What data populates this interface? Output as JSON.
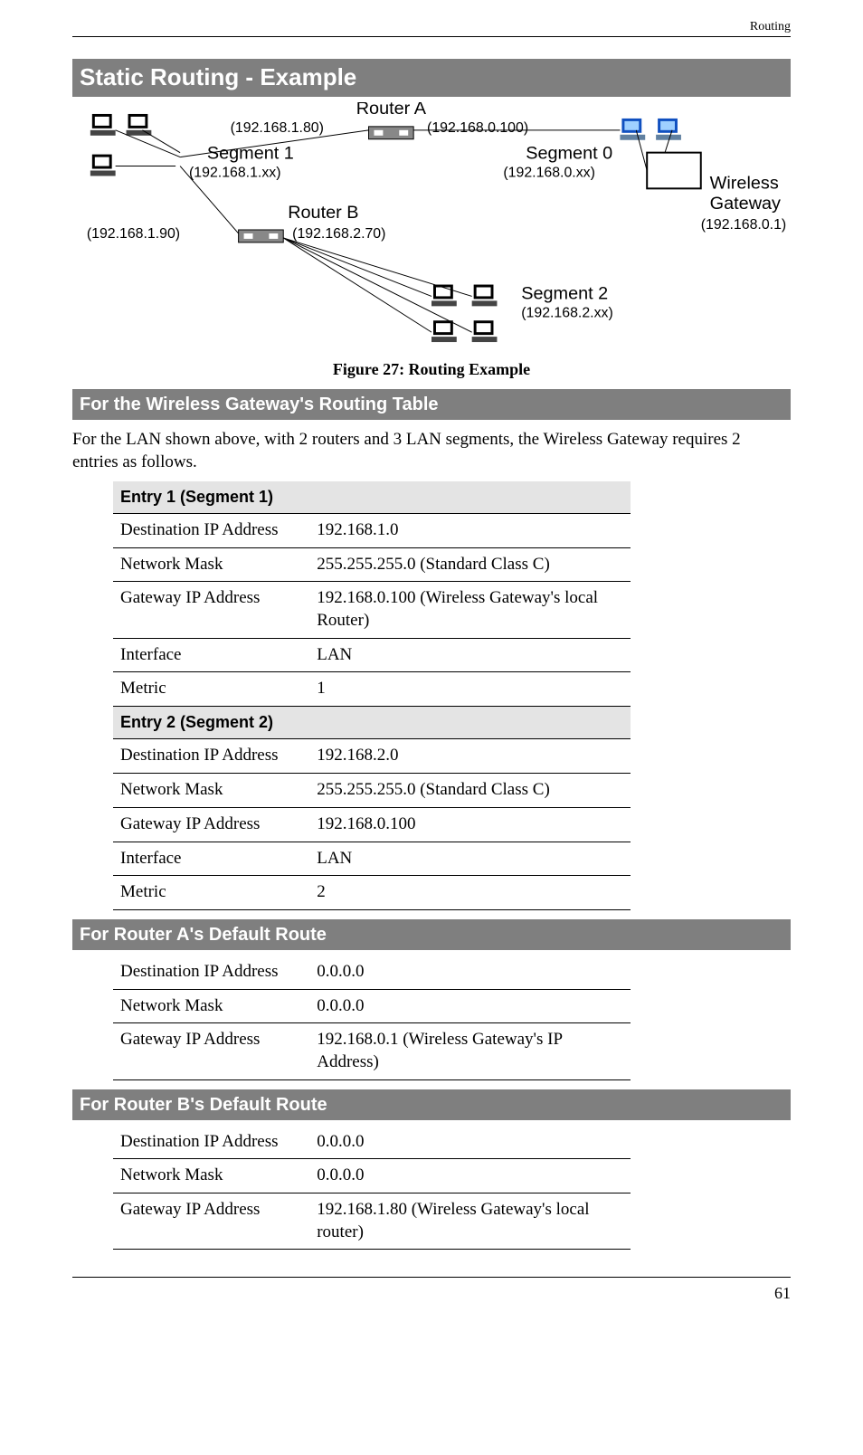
{
  "running_head": "Routing",
  "h1": "Static Routing -  Example",
  "diagram": {
    "router_a": "Router A",
    "router_a_left_ip": "(192.168.1.80)",
    "router_a_right_ip": "(192.168.0.100)",
    "segment1": "Segment 1",
    "segment1_ip": "(192.168.1.xx)",
    "segment0": "Segment 0",
    "segment0_ip": "(192.168.0.xx)",
    "router_b": "Router B",
    "router_b_left_ip": "(192.168.1.90)",
    "router_b_right_ip": "(192.168.2.70)",
    "segment2": "Segment 2",
    "segment2_ip": "(192.168.2.xx)",
    "wireless": "Wireless",
    "gateway": "Gateway",
    "gateway_ip": "(192.168.0.1)"
  },
  "caption": "Figure 27: Routing Example",
  "h2_wg": "For the Wireless Gateway's Routing Table",
  "intro": "For the LAN shown above, with 2 routers and 3 LAN segments, the Wireless Gateway requires 2 entries as follows.",
  "labels": {
    "dest": "Destination IP Address",
    "mask": "Network Mask",
    "gw": "Gateway IP Address",
    "iface": "Interface",
    "metric": "Metric"
  },
  "entry1_hdr": "Entry 1 (Segment 1)",
  "entry1": {
    "dest": "192.168.1.0",
    "mask": "255.255.255.0  (Standard Class C)",
    "gw": "192.168.0.100  (Wireless Gateway's local Router)",
    "iface": "LAN",
    "metric": "1"
  },
  "entry2_hdr": "Entry 2 (Segment 2)",
  "entry2": {
    "dest": "192.168.2.0",
    "mask": "255.255.255.0  (Standard Class C)",
    "gw": "192.168.0.100",
    "iface": "LAN",
    "metric": "2"
  },
  "h2_a": "For Router A's Default Route",
  "router_a_route": {
    "dest": "0.0.0.0",
    "mask": "0.0.0.0",
    "gw": "192.168.0.1  (Wireless Gateway's IP Address)"
  },
  "h2_b": "For Router B's Default Route",
  "router_b_route": {
    "dest": "0.0.0.0",
    "mask": "0.0.0.0",
    "gw": "192.168.1.80 (Wireless Gateway's local router)"
  },
  "page_number": "61"
}
